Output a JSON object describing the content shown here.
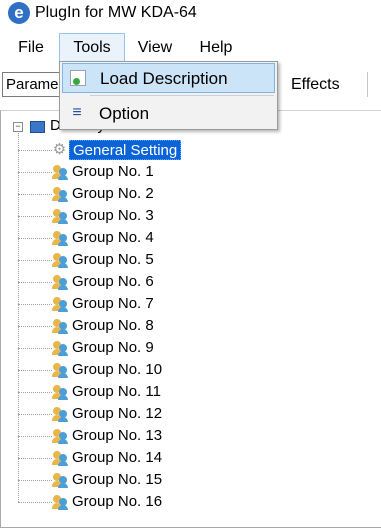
{
  "window": {
    "title": "PlugIn for MW KDA-64",
    "app_icon_glyph": "e"
  },
  "menubar": {
    "file": "File",
    "tools": "Tools",
    "view": "View",
    "help": "Help"
  },
  "tools_menu": {
    "items": [
      {
        "label": "Load Description",
        "icon": "load-description-icon",
        "highlighted": true
      },
      {
        "label": "Option",
        "icon": "option-icon",
        "highlighted": false
      }
    ]
  },
  "tabs": {
    "parameters": "Parame",
    "effects": "Effects"
  },
  "tree": {
    "root_label": "DALI System",
    "expand_glyph": "−",
    "general_setting": "General Setting",
    "groups": [
      "Group No. 1",
      "Group No. 2",
      "Group No. 3",
      "Group No. 4",
      "Group No. 5",
      "Group No. 6",
      "Group No. 7",
      "Group No. 8",
      "Group No. 9",
      "Group No. 10",
      "Group No. 11",
      "Group No. 12",
      "Group No. 13",
      "Group No. 14",
      "Group No. 15",
      "Group No. 16"
    ]
  },
  "colors": {
    "selection": "#0a64d8",
    "menu_highlight": "#cce4f7",
    "app_icon": "#2f6fc4"
  }
}
